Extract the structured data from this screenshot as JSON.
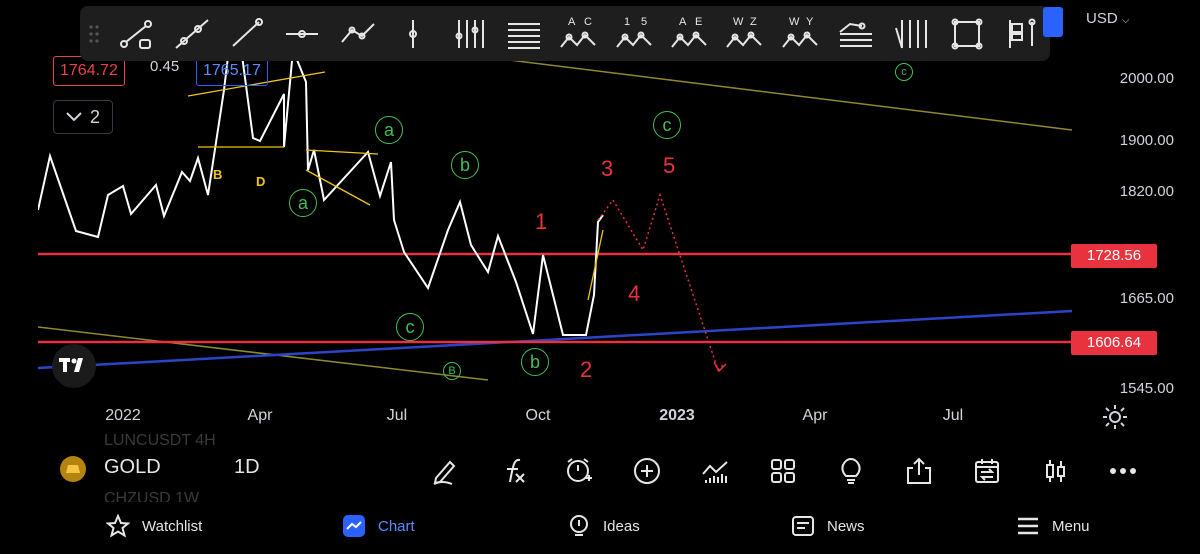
{
  "toolbar": {
    "tools": [
      {
        "name": "trend-line-icon",
        "label": ""
      },
      {
        "name": "ray-icon",
        "label": ""
      },
      {
        "name": "extended-line-icon",
        "label": ""
      },
      {
        "name": "horizontal-line-icon",
        "label": ""
      },
      {
        "name": "path-icon",
        "label": ""
      },
      {
        "name": "vertical-line-icon",
        "label": ""
      },
      {
        "name": "cross-lines-icon",
        "label": ""
      },
      {
        "name": "parallel-channel-icon",
        "label": ""
      },
      {
        "name": "elliott-ac-wave-icon",
        "label": "A C"
      },
      {
        "name": "elliott-impulse-wave-icon",
        "label": "1 5"
      },
      {
        "name": "elliott-ae-wave-icon",
        "label": "A E"
      },
      {
        "name": "elliott-wz-wave-icon",
        "label": "W Z"
      },
      {
        "name": "elliott-wy-wave-icon",
        "label": "W Y"
      },
      {
        "name": "fib-retracement-icon",
        "label": ""
      },
      {
        "name": "pitchfork-icon",
        "label": ""
      },
      {
        "name": "rectangle-icon",
        "label": ""
      },
      {
        "name": "long-position-icon",
        "label": ""
      }
    ]
  },
  "header": {
    "symbol_ghost": "Go",
    "last_price": "1764.72",
    "change": "0.45",
    "ask_price": "1765.17",
    "indicator_count": "2",
    "currency": "USD"
  },
  "price_scale": {
    "ticks": [
      "2000.00",
      "1900.00",
      "1820.00",
      "1665.00",
      "1545.00"
    ],
    "tags": [
      {
        "value": "1728.56"
      },
      {
        "value": "1606.64"
      }
    ]
  },
  "time_scale": {
    "ticks": [
      "2022",
      "Apr",
      "Jul",
      "Oct",
      "2023",
      "Apr",
      "Jul"
    ]
  },
  "annotations": {
    "green": [
      "a",
      "b",
      "a",
      "c",
      "b",
      "c",
      "B",
      "c"
    ],
    "red": [
      "1",
      "2",
      "3",
      "4",
      "5"
    ],
    "yellow": [
      "B",
      "D"
    ]
  },
  "colors": {
    "red_line": "#e8323d",
    "blue_trend": "#2a45c8",
    "olive_trend": "#8d8a2c",
    "wave_green": "#3fbf5a",
    "projection_red": "#e8323d",
    "accent_blue": "#2962ff"
  },
  "symbol_bar": {
    "symbol": "GOLD",
    "interval": "1D",
    "ghost_symbols": [
      "LUNCUSDT 4H",
      "CHZUSD 1W"
    ]
  },
  "nav": {
    "items": [
      {
        "label": "Watchlist",
        "icon": "star-icon"
      },
      {
        "label": "Chart",
        "icon": "chart-icon"
      },
      {
        "label": "Ideas",
        "icon": "lightbulb-icon"
      },
      {
        "label": "News",
        "icon": "newspaper-icon"
      },
      {
        "label": "Menu",
        "icon": "hamburger-icon"
      }
    ]
  }
}
